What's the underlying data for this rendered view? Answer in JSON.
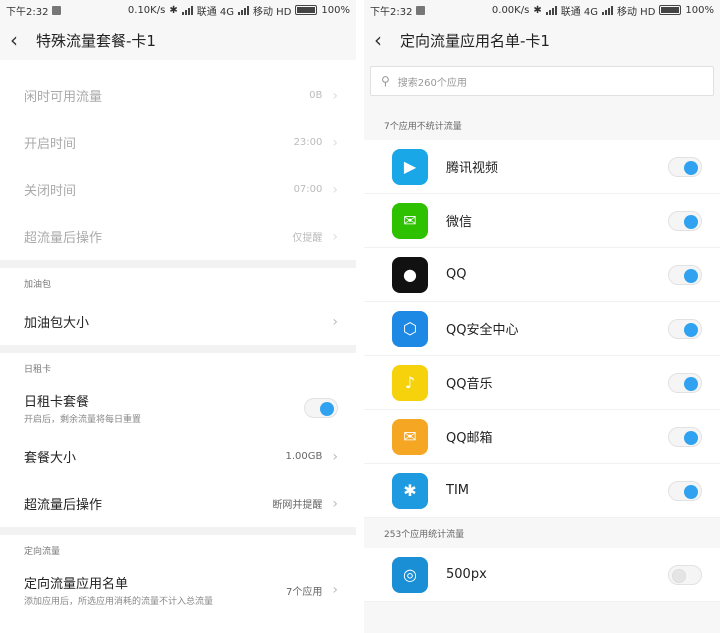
{
  "left": {
    "status": {
      "time": "下午2:32",
      "speed": "0.10K/s",
      "carrier1": "联通 4G",
      "carrier2": "移动 HD",
      "battery": "100%"
    },
    "title": "特殊流量套餐-卡1",
    "rows_top": [
      {
        "label": "闲时可用流量",
        "value": "0B"
      },
      {
        "label": "开启时间",
        "value": "23:00"
      },
      {
        "label": "关闭时间",
        "value": "07:00"
      },
      {
        "label": "超流量后操作",
        "value": "仅提醒"
      }
    ],
    "section_refuel": "加油包",
    "refuel_size": "加油包大小",
    "section_daily": "日租卡",
    "daily_plan": {
      "label": "日租卡套餐",
      "desc": "开启后，剩余流量将每日重置"
    },
    "plan_size": {
      "label": "套餐大小",
      "value": "1.00GB"
    },
    "over_action": {
      "label": "超流量后操作",
      "value": "断网并提醒"
    },
    "section_directed": "定向流量",
    "directed_list": {
      "label": "定向流量应用名单",
      "desc": "添加应用后，所选应用消耗的流量不计入总流量",
      "value": "7个应用"
    }
  },
  "right": {
    "status": {
      "time": "下午2:32",
      "speed": "0.00K/s",
      "carrier1": "联通 4G",
      "carrier2": "移动 HD",
      "battery": "100%"
    },
    "title": "定向流量应用名单-卡1",
    "search_placeholder": "搜索260个应用",
    "group1": "7个应用不统计流量",
    "apps_excluded": [
      {
        "name": "腾讯视频",
        "icon": "tencent-video-icon",
        "color": "#1aa7e8",
        "on": true
      },
      {
        "name": "微信",
        "icon": "wechat-icon",
        "color": "#2dc100",
        "on": true
      },
      {
        "name": "QQ",
        "icon": "qq-penguin-icon",
        "color": "#111111",
        "on": true
      },
      {
        "name": "QQ安全中心",
        "icon": "qq-security-icon",
        "color": "#1e88e5",
        "on": true
      },
      {
        "name": "QQ音乐",
        "icon": "qq-music-icon",
        "color": "#f5d20c",
        "on": true
      },
      {
        "name": "QQ邮箱",
        "icon": "qq-mail-icon",
        "color": "#f5a623",
        "on": true
      },
      {
        "name": "TIM",
        "icon": "tim-icon",
        "color": "#1e9be0",
        "on": true
      }
    ],
    "group2": "253个应用统计流量",
    "apps_counted": [
      {
        "name": "500px",
        "icon": "500px-icon",
        "color": "#1b8fd6",
        "on": false
      }
    ]
  }
}
